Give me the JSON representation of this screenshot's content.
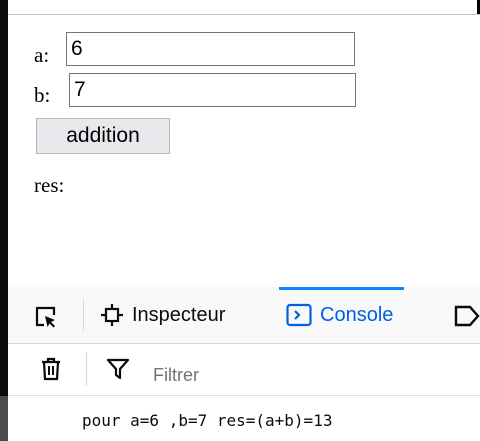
{
  "page": {
    "label_a": "a:",
    "value_a": "6",
    "label_b": "b:",
    "value_b": "7",
    "button_label": "addition",
    "result_label": "res:"
  },
  "devtools": {
    "tabs": [
      {
        "label": "Inspecteur",
        "icon": "inspector-icon"
      },
      {
        "label": "Console",
        "icon": "console-icon",
        "active": true
      }
    ],
    "toolbar": {
      "filter_placeholder": "Filtrer"
    },
    "console_output": "pour a=6 ,b=7 res=(a+b)=13"
  },
  "colors": {
    "active_tab": "#0061e0",
    "tab_underline": "#0a84ff"
  }
}
